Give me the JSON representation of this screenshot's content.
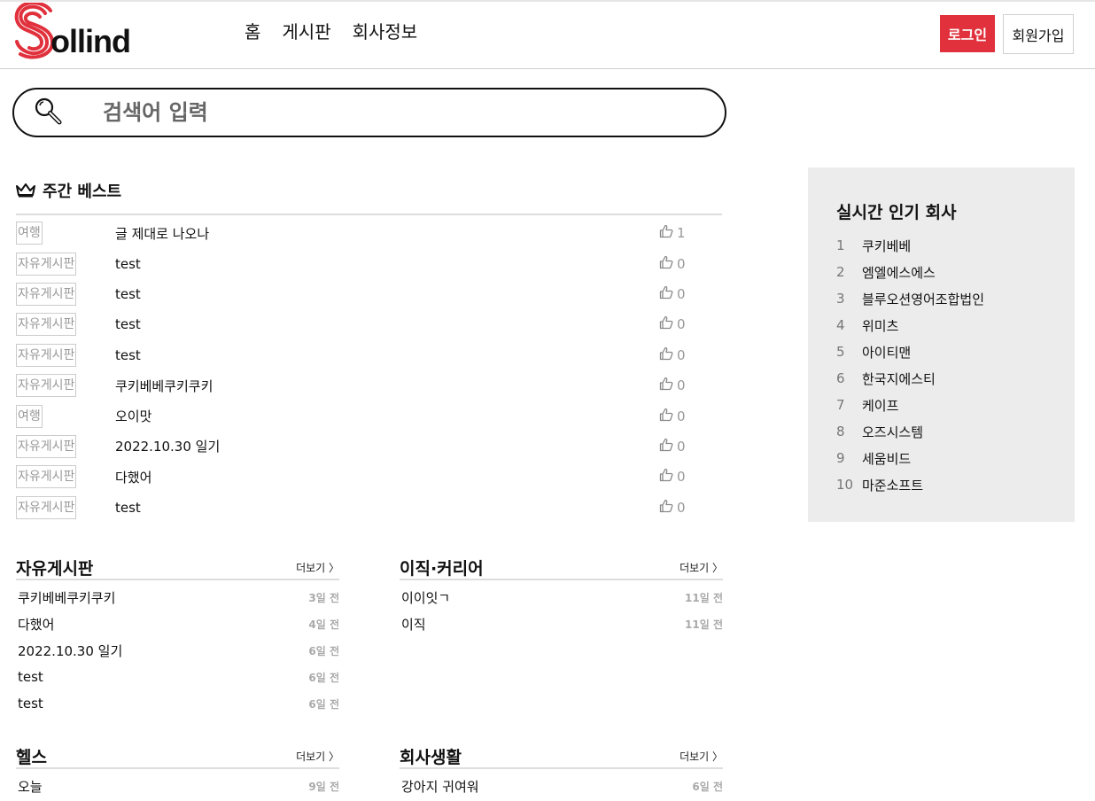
{
  "header": {
    "logo_text": "ollind",
    "nav": [
      "홈",
      "게시판",
      "회사정보"
    ],
    "login": "로그인",
    "join": "회원가입"
  },
  "search": {
    "placeholder": "검색어 입력"
  },
  "weekly_best": {
    "title": "주간 베스트",
    "rows": [
      {
        "tag": "여행",
        "title": "글 제대로 나오나",
        "likes": "1"
      },
      {
        "tag": "자유게시판",
        "title": "test",
        "likes": "0"
      },
      {
        "tag": "자유게시판",
        "title": "test",
        "likes": "0"
      },
      {
        "tag": "자유게시판",
        "title": "test",
        "likes": "0"
      },
      {
        "tag": "자유게시판",
        "title": "test",
        "likes": "0"
      },
      {
        "tag": "자유게시판",
        "title": "쿠키베베쿠키쿠키",
        "likes": "0"
      },
      {
        "tag": "여행",
        "title": "오이맛",
        "likes": "0"
      },
      {
        "tag": "자유게시판",
        "title": "2022.10.30 일기",
        "likes": "0"
      },
      {
        "tag": "자유게시판",
        "title": "다했어",
        "likes": "0"
      },
      {
        "tag": "자유게시판",
        "title": "test",
        "likes": "0"
      }
    ]
  },
  "popular": {
    "title": "실시간 인기 회사",
    "items": [
      {
        "rank": "1",
        "name": "쿠키베베"
      },
      {
        "rank": "2",
        "name": "엠엘에스에스"
      },
      {
        "rank": "3",
        "name": "블루오션영어조합법인"
      },
      {
        "rank": "4",
        "name": "위미츠"
      },
      {
        "rank": "5",
        "name": "아이티맨"
      },
      {
        "rank": "6",
        "name": "한국지에스티"
      },
      {
        "rank": "7",
        "name": "케이프"
      },
      {
        "rank": "8",
        "name": "오즈시스템"
      },
      {
        "rank": "9",
        "name": "세움비드"
      },
      {
        "rank": "10",
        "name": "마준소프트"
      }
    ]
  },
  "boards": [
    {
      "name": "자유게시판",
      "more": "더보기 〉",
      "items": [
        {
          "title": "쿠키베베쿠키쿠키",
          "date": "3일 전"
        },
        {
          "title": "다했어",
          "date": "4일 전"
        },
        {
          "title": "2022.10.30 일기",
          "date": "6일 전"
        },
        {
          "title": "test",
          "date": "6일 전"
        },
        {
          "title": "test",
          "date": "6일 전"
        }
      ]
    },
    {
      "name": "이직·커리어",
      "more": "더보기 〉",
      "items": [
        {
          "title": "이이잇ㄱ",
          "date": "11일 전"
        },
        {
          "title": "이직",
          "date": "11일 전"
        }
      ]
    },
    {
      "name": "헬스",
      "more": "더보기 〉",
      "items": [
        {
          "title": "오늘",
          "date": "9일 전"
        }
      ]
    },
    {
      "name": "회사생활",
      "more": "더보기 〉",
      "items": [
        {
          "title": "강아지 귀여워",
          "date": "6일 전"
        }
      ]
    }
  ],
  "colors": {
    "accent": "#e0313c",
    "panel": "#ececec"
  }
}
